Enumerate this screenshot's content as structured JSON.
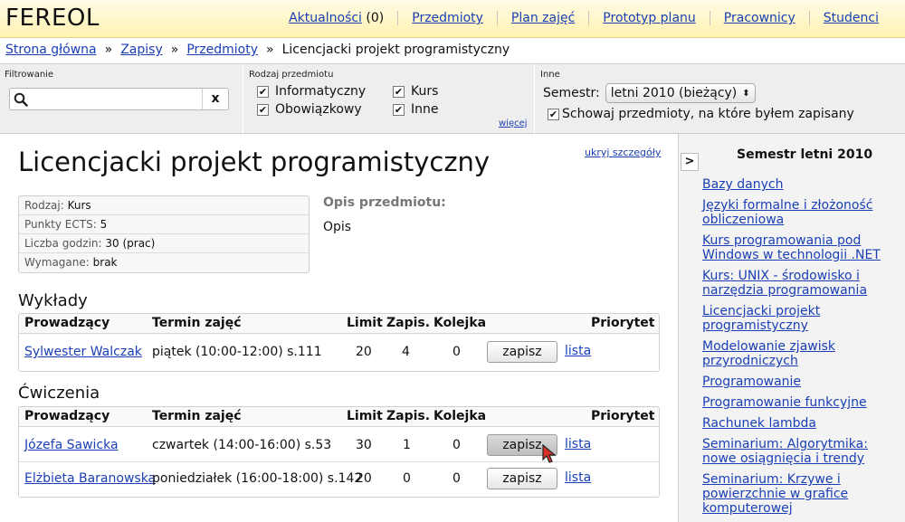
{
  "app": {
    "title": "FEREOL"
  },
  "topnav": [
    {
      "label": "Aktualności",
      "count": "(0)"
    },
    {
      "label": "Przedmioty"
    },
    {
      "label": "Plan zajęć"
    },
    {
      "label": "Prototyp planu"
    },
    {
      "label": "Pracownicy"
    },
    {
      "label": "Studenci"
    }
  ],
  "breadcrumb": {
    "items": [
      "Strona główna",
      "Zapisy",
      "Przedmioty"
    ],
    "current": "Licencjacki projekt programistyczny",
    "separator": "»"
  },
  "filters": {
    "search_title": "Filtrowanie",
    "search_value": "",
    "clear_label": "x",
    "type_title": "Rodzaj przedmiotu",
    "types": [
      {
        "label": "Informatyczny",
        "checked": true
      },
      {
        "label": "Obowiązkowy",
        "checked": true
      },
      {
        "label": "Kurs",
        "checked": true
      },
      {
        "label": "Inne",
        "checked": true
      }
    ],
    "more_label": "więcej",
    "other_title": "Inne",
    "semester_label": "Semestr:",
    "semester_value": "letni 2010 (bieżący)",
    "hide_enrolled_label": "Schowaj przedmioty, na które byłem zapisany",
    "hide_enrolled_checked": true
  },
  "course": {
    "hide_details_label": "ukryj szczegóły",
    "title": "Licencjacki projekt programistyczny",
    "info": [
      {
        "key": "Rodzaj:",
        "value": "Kurs"
      },
      {
        "key": "Punkty ECTS:",
        "value": "5"
      },
      {
        "key": "Liczba godzin:",
        "value": "30 (prac)"
      },
      {
        "key": "Wymagane:",
        "value": "brak"
      }
    ],
    "description_title": "Opis przedmiotu:",
    "description": "Opis"
  },
  "table_headers": {
    "teacher": "Prowadzący",
    "term": "Termin zajęć",
    "limit": "Limit",
    "enrolled": "Zapis.",
    "queue": "Kolejka",
    "priority": "Priorytet"
  },
  "lectures": {
    "title": "Wykłady",
    "rows": [
      {
        "teacher": "Sylwester Walczak",
        "term": "piątek (10:00-12:00) s.111",
        "limit": "20",
        "enrolled": "4",
        "queue": "0",
        "action": "zapisz",
        "list": "lista"
      }
    ]
  },
  "exercises": {
    "title": "Ćwiczenia",
    "rows": [
      {
        "teacher": "Józefa Sawicka",
        "term": "czwartek (14:00-16:00) s.53",
        "limit": "30",
        "enrolled": "1",
        "queue": "0",
        "action": "zapisz",
        "list": "lista"
      },
      {
        "teacher": "Elżbieta Baranowska",
        "term": "poniedziałek (16:00-18:00) s.142",
        "limit": "20",
        "enrolled": "0",
        "queue": "0",
        "action": "zapisz",
        "list": "lista"
      }
    ]
  },
  "sidebar": {
    "toggle_label": ">",
    "title": "Semestr letni 2010",
    "courses": [
      "Bazy danych",
      "Języki formalne i złożoność obliczeniowa",
      "Kurs programowania pod Windows w technologii .NET",
      "Kurs: UNIX - środowisko i narzędzia programowania",
      "Licencjacki projekt programistyczny",
      "Modelowanie zjawisk przyrodniczych",
      "Programowanie",
      "Programowanie funkcyjne",
      "Rachunek lambda",
      "Seminarium: Algorytmika: nowe osiągnięcia i trendy",
      "Seminarium: Krzywe i powierzchnie w grafice komputerowej"
    ]
  },
  "colors": {
    "link": "#1a3fb5",
    "header_bg": "#fff2b0",
    "filter_bg": "#eeeeee",
    "sidebar_bg": "#f3f3f3"
  }
}
